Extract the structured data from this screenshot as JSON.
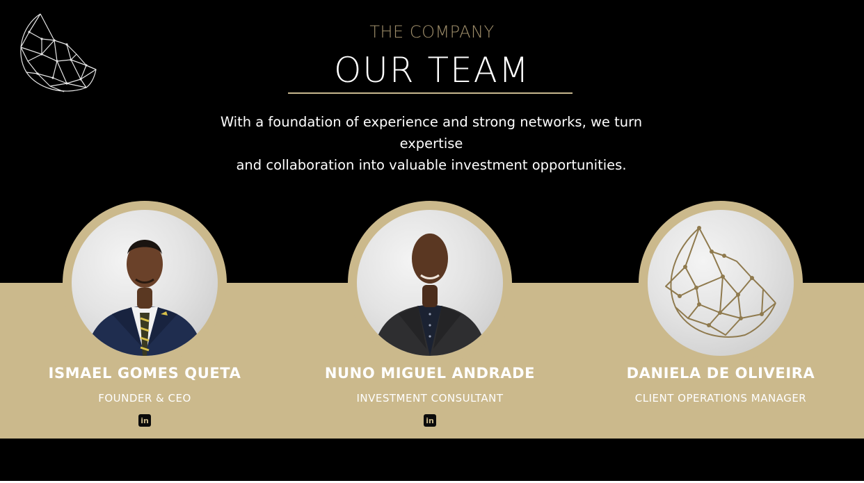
{
  "header": {
    "kicker": "THE COMPANY",
    "title": "OUR TEAM",
    "intro_line1": "With a foundation of experience and strong networks, we turn expertise",
    "intro_line2": "and collaboration into valuable investment opportunities."
  },
  "colors": {
    "background": "#000000",
    "gold": "#cbb98c",
    "gold_dark": "#8f7a4e",
    "text": "#ffffff"
  },
  "team": [
    {
      "name": "ISMAEL GOMES QUETA",
      "role": "FOUNDER & CEO",
      "linkedin_icon": "linkedin-icon",
      "linkedin_label": "in"
    },
    {
      "name": "NUNO MIGUEL ANDRADE",
      "role": "INVESTMENT CONSULTANT",
      "linkedin_icon": "linkedin-icon",
      "linkedin_label": "in"
    },
    {
      "name": "DANIELA DE OLIVEIRA",
      "role": "CLIENT OPERATIONS MANAGER"
    }
  ]
}
